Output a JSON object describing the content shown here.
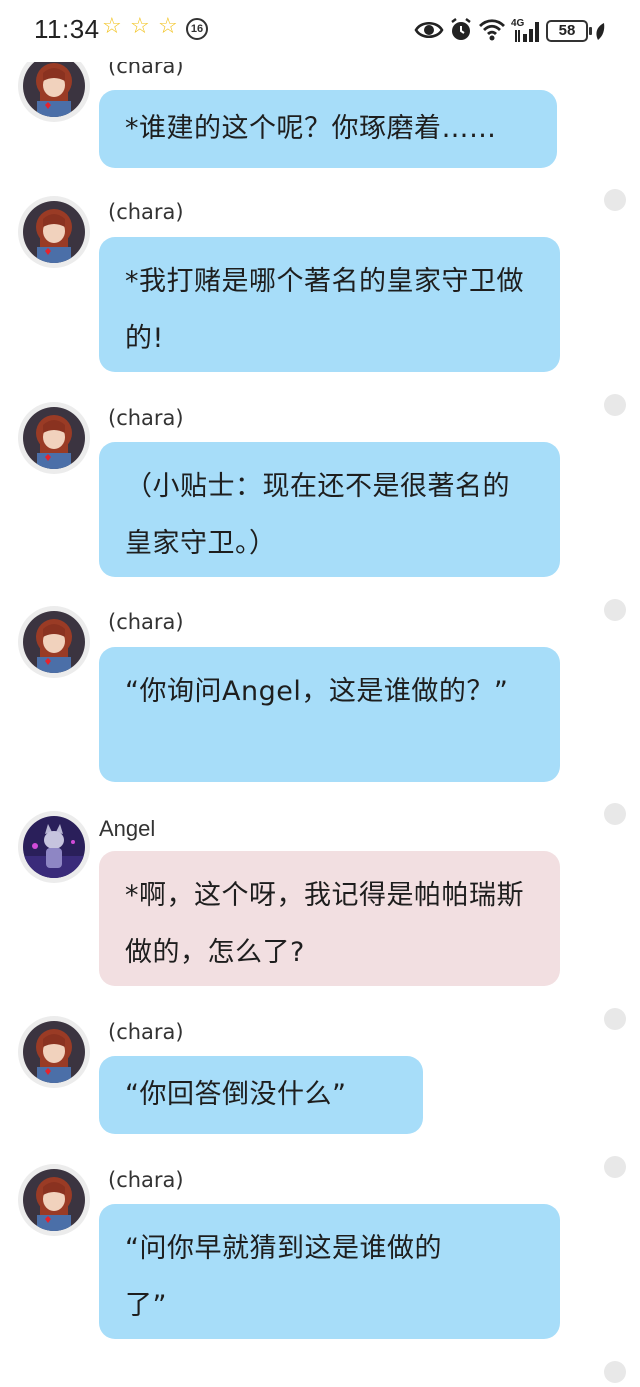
{
  "status_bar": {
    "time": "11:34",
    "notification_badge": "16",
    "battery_level": "58",
    "network_type": "4G"
  },
  "messages": [
    {
      "sender": "(chara)",
      "text": "*谁建的这个呢？你琢磨着……",
      "bubble_color": "#a7ddf9"
    },
    {
      "sender": "(chara)",
      "text": "*我打赌是哪个著名的皇家守卫做的!",
      "bubble_color": "#a7ddf9"
    },
    {
      "sender": "(chara)",
      "text": "（小贴士：现在还不是很著名的皇家守卫。）",
      "bubble_color": "#a7ddf9"
    },
    {
      "sender": "(chara)",
      "text": "“你询问Angel，这是谁做的？”",
      "bubble_color": "#a7ddf9"
    },
    {
      "sender": "Angel",
      "text": "*啊，这个呀，我记得是帕帕瑞斯做的，怎么了?",
      "bubble_color": "#f2dfe1"
    },
    {
      "sender": "(chara)",
      "text": "“你回答倒没什么”",
      "bubble_color": "#a7ddf9"
    },
    {
      "sender": "(chara)",
      "text": "“问你早就猜到这是谁做的了”",
      "bubble_color": "#a7ddf9"
    }
  ]
}
